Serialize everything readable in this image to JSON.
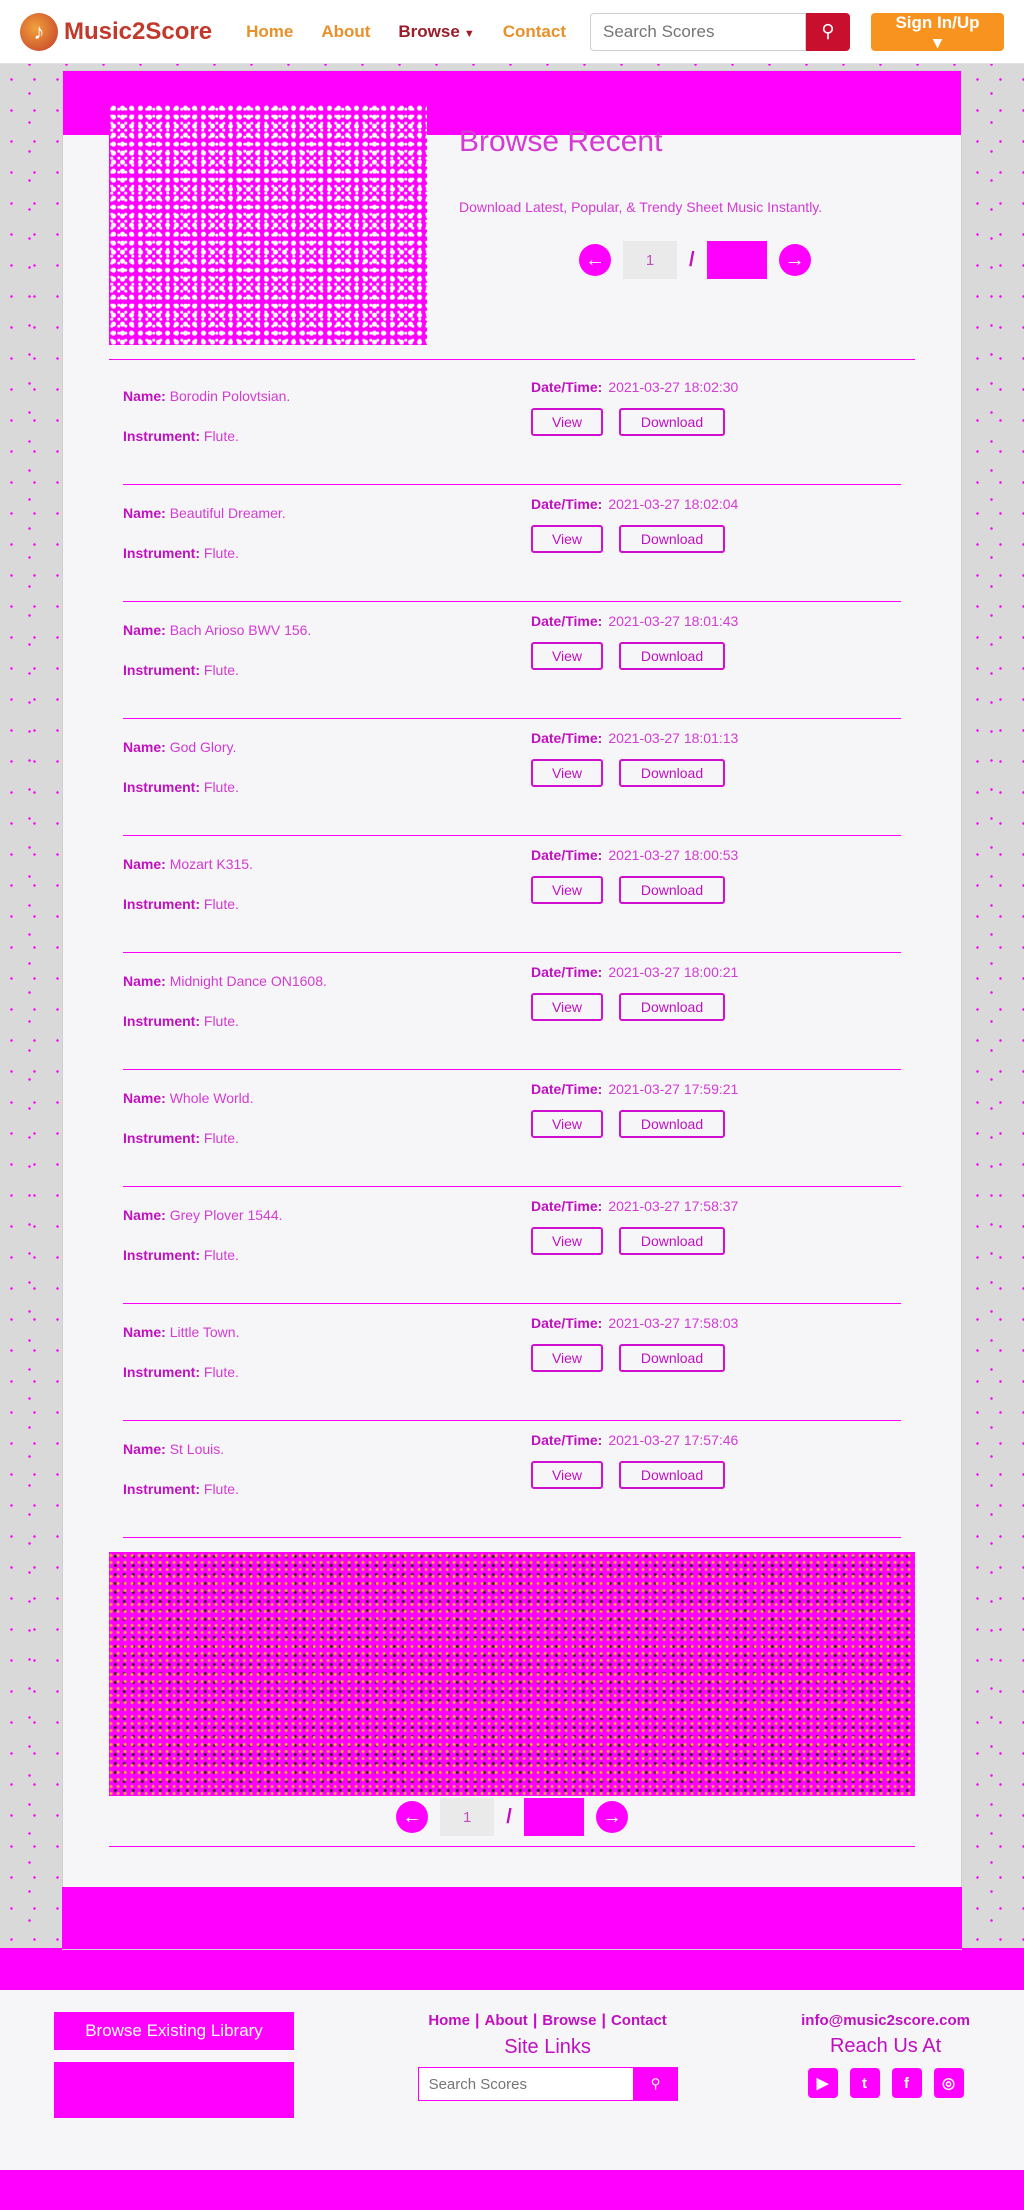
{
  "nav": {
    "brand": "Music2Score",
    "brand_icon": "music-note-icon",
    "links": [
      {
        "label": "Home"
      },
      {
        "label": "About"
      },
      {
        "label": "Browse"
      },
      {
        "label": "Contact"
      }
    ],
    "search_placeholder": "Search Scores",
    "signin_label": "Sign In/Up"
  },
  "hero": {
    "title": "Browse Recent",
    "subtitle": "Download Latest, Popular, & Trendy Sheet Music Instantly.",
    "page_current": "1",
    "page_sep": "/"
  },
  "labels": {
    "name": "Name:",
    "instrument": "Instrument:",
    "datetime": "Date/Time:",
    "view": "View",
    "download": "Download"
  },
  "scores": [
    {
      "name": "Borodin Polovtsian.",
      "instrument": "Flute.",
      "datetime": "2021-03-27 18:02:30"
    },
    {
      "name": "Beautiful Dreamer.",
      "instrument": "Flute.",
      "datetime": "2021-03-27 18:02:04"
    },
    {
      "name": "Bach Arioso BWV 156.",
      "instrument": "Flute.",
      "datetime": "2021-03-27 18:01:43"
    },
    {
      "name": "God Glory.",
      "instrument": "Flute.",
      "datetime": "2021-03-27 18:01:13"
    },
    {
      "name": "Mozart K315.",
      "instrument": "Flute.",
      "datetime": "2021-03-27 18:00:53"
    },
    {
      "name": "Midnight Dance ON1608.",
      "instrument": "Flute.",
      "datetime": "2021-03-27 18:00:21"
    },
    {
      "name": "Whole World.",
      "instrument": "Flute.",
      "datetime": "2021-03-27 17:59:21"
    },
    {
      "name": "Grey Plover 1544.",
      "instrument": "Flute.",
      "datetime": "2021-03-27 17:58:37"
    },
    {
      "name": "Little Town.",
      "instrument": "Flute.",
      "datetime": "2021-03-27 17:58:03"
    },
    {
      "name": "St Louis.",
      "instrument": "Flute.",
      "datetime": "2021-03-27 17:57:46"
    }
  ],
  "footer": {
    "browse_library": "Browse Existing Library",
    "links": [
      "Home",
      "About",
      "Browse",
      "Contact"
    ],
    "site_links_heading": "Site Links",
    "search_placeholder": "Search Scores",
    "email": "info@music2score.com",
    "reach_heading": "Reach Us At",
    "socials": [
      "youtube-icon",
      "twitter-icon",
      "facebook-icon",
      "instagram-icon"
    ]
  },
  "colors": {
    "brand_red": "#c0392b",
    "nav_orange": "#e8902a",
    "accent_magenta": "#ff00ff",
    "search_red": "#c8102e",
    "signin_orange": "#f7931e"
  }
}
